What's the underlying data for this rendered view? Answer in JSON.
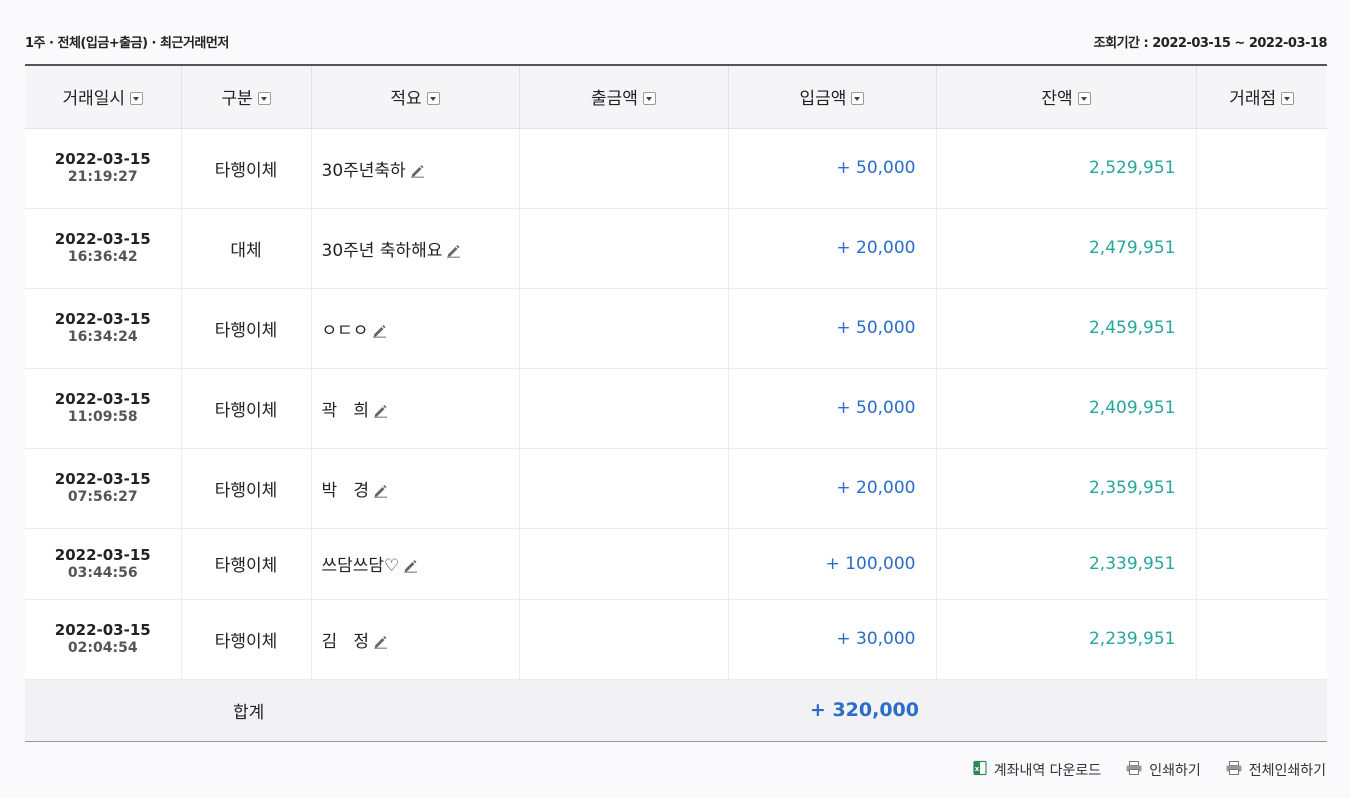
{
  "filter_text": "1주 · 전체(입금+출금) · 최근거래먼저",
  "period": {
    "label": "조회기간 : 2022-03-15 ~ 2022-03-18"
  },
  "columns": [
    "거래일시",
    "구분",
    "적요",
    "출금액",
    "입금액",
    "잔액",
    "거래점"
  ],
  "rows": [
    {
      "date": "2022-03-15",
      "time": "21:19:27",
      "type": "타행이체",
      "memo": "30주년축하",
      "withdrawal": "",
      "deposit": "+ 50,000",
      "balance": "2,529,951",
      "branch": ""
    },
    {
      "date": "2022-03-15",
      "time": "16:36:42",
      "type": "대체",
      "memo": "30주년 축하해요",
      "withdrawal": "",
      "deposit": "+ 20,000",
      "balance": "2,479,951",
      "branch": ""
    },
    {
      "date": "2022-03-15",
      "time": "16:34:24",
      "type": "타행이체",
      "memo": "ㅇㄷㅇ",
      "withdrawal": "",
      "deposit": "+ 50,000",
      "balance": "2,459,951",
      "branch": ""
    },
    {
      "date": "2022-03-15",
      "time": "11:09:58",
      "type": "타행이체",
      "memo": "곽   희",
      "withdrawal": "",
      "deposit": "+ 50,000",
      "balance": "2,409,951",
      "branch": ""
    },
    {
      "date": "2022-03-15",
      "time": "07:56:27",
      "type": "타행이체",
      "memo": "박   경",
      "withdrawal": "",
      "deposit": "+ 20,000",
      "balance": "2,359,951",
      "branch": ""
    },
    {
      "date": "2022-03-15",
      "time": "03:44:56",
      "type": "타행이체",
      "memo": "쓰담쓰담♡",
      "withdrawal": "",
      "deposit": "+ 100,000",
      "balance": "2,339,951",
      "branch": ""
    },
    {
      "date": "2022-03-15",
      "time": "02:04:54",
      "type": "타행이체",
      "memo": "김   정",
      "withdrawal": "",
      "deposit": "+ 30,000",
      "balance": "2,239,951",
      "branch": ""
    }
  ],
  "total": {
    "label": "합계",
    "amount": "+ 320,000"
  },
  "actions": {
    "download": "계좌내역 다운로드",
    "print": "인쇄하기",
    "print_all": "전체인쇄하기"
  },
  "colors": {
    "deposit": "#2a6cc8",
    "balance": "#25a69a"
  }
}
